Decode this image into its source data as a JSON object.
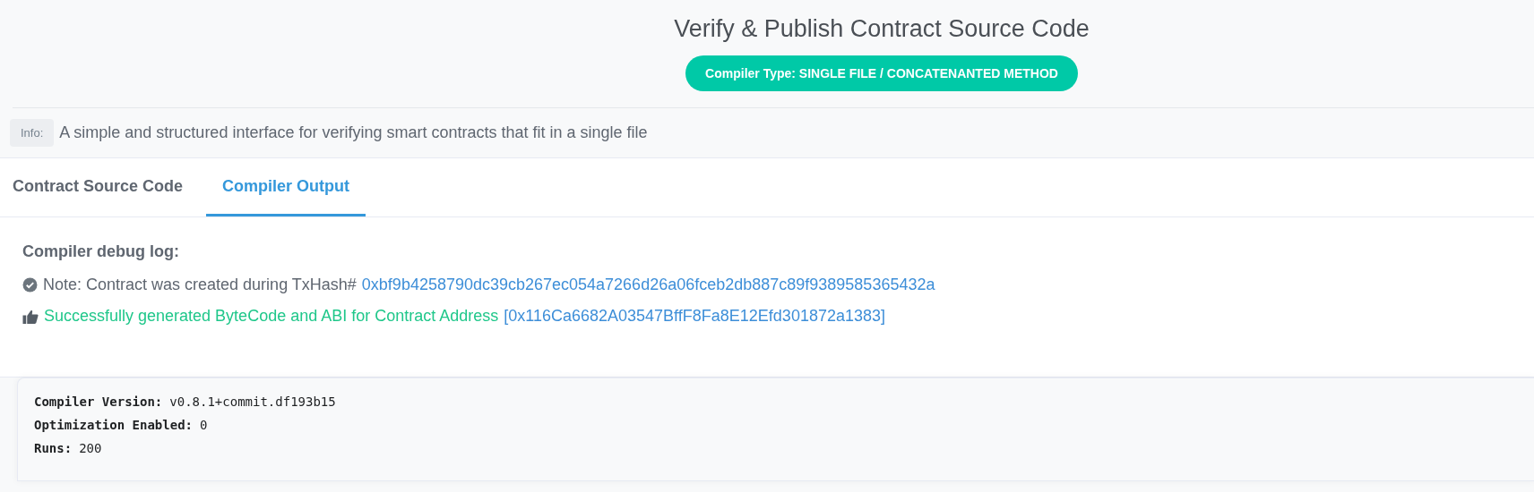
{
  "header": {
    "title": "Verify & Publish Contract Source Code",
    "badge": {
      "label": "Compiler Type:",
      "value": "SINGLE FILE / CONCATENANTED METHOD"
    }
  },
  "info": {
    "tag": "Info:",
    "text": "A simple and structured interface for verifying smart contracts that fit in a single file"
  },
  "tabs": [
    {
      "label": "Contract Source Code",
      "selected": false
    },
    {
      "label": "Compiler Output",
      "selected": true
    }
  ],
  "log": {
    "title": "Compiler debug log:",
    "note": {
      "text": "Note: Contract was created during TxHash#",
      "link": "0xbf9b4258790dc39cb267ec054a7266d26a06fceb2db887c89f9389585365432a"
    },
    "success": {
      "text": "Successfully generated ByteCode and ABI for Contract Address",
      "link": "[0x116Ca6682A03547BffF8Fa8E12Efd301872a1383]"
    }
  },
  "details": [
    {
      "label": "Compiler Version:",
      "value": "v0.8.1+commit.df193b15"
    },
    {
      "label": "Optimization Enabled:",
      "value": "0"
    },
    {
      "label": "Runs:",
      "value": "200"
    }
  ]
}
